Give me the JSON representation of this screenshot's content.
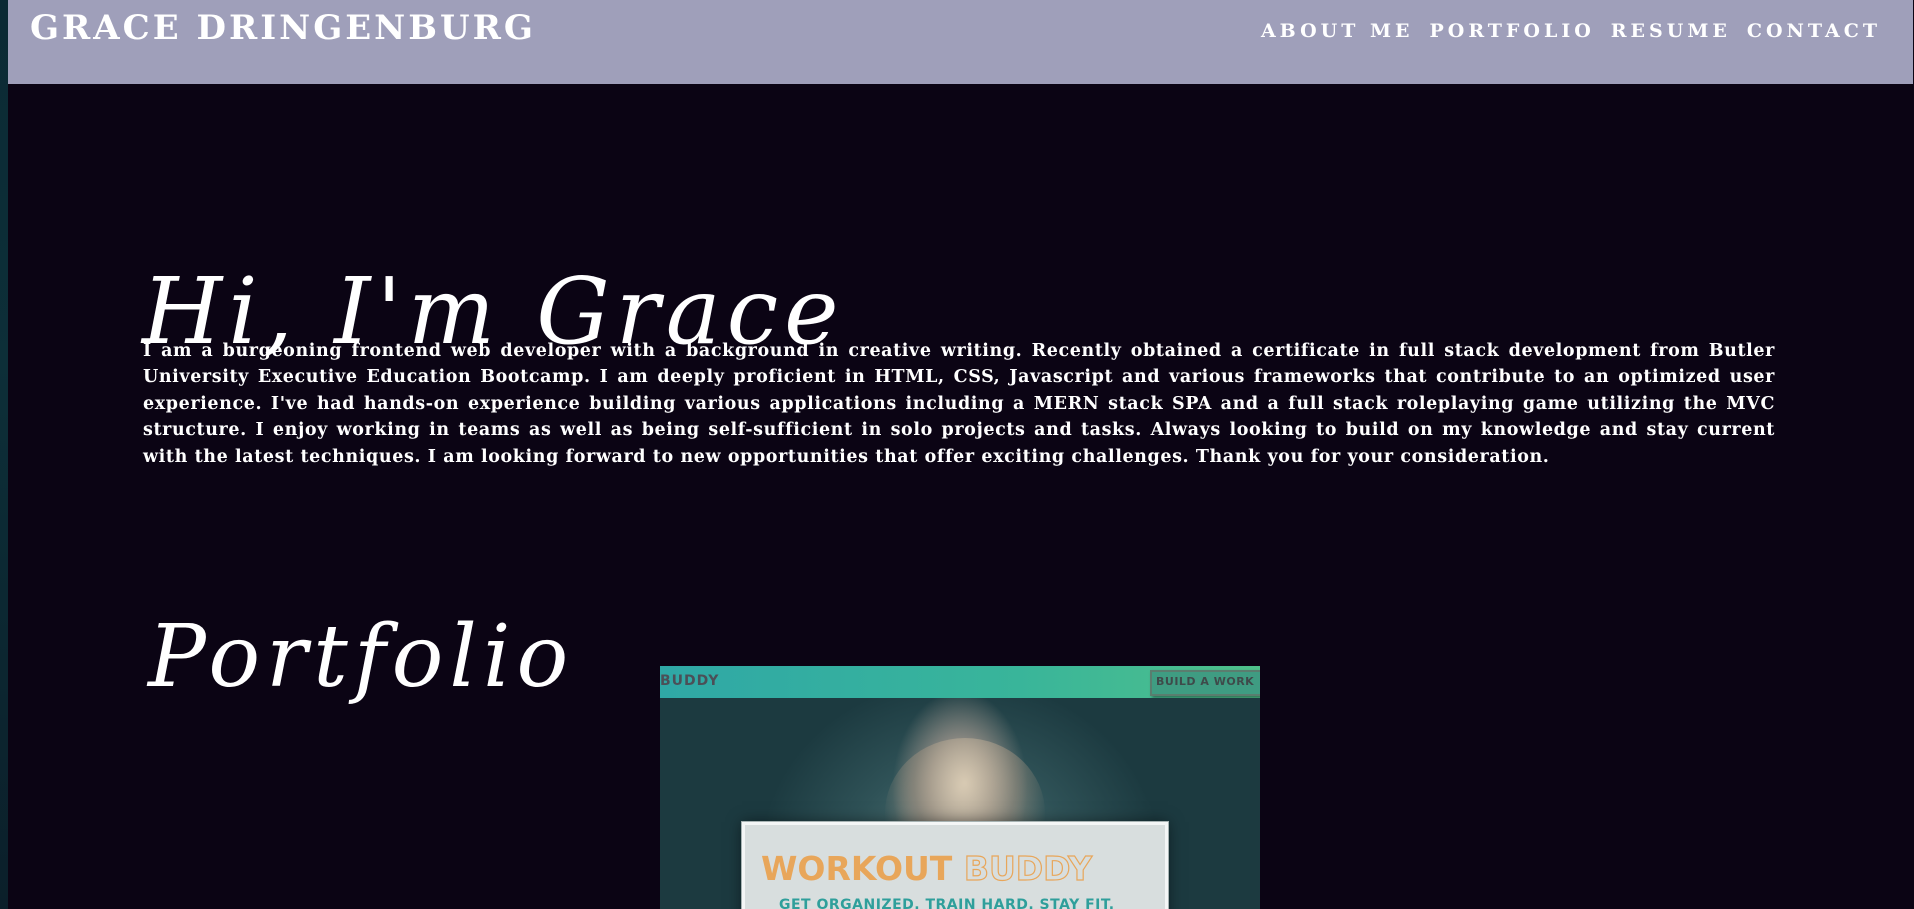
{
  "header": {
    "brand": "GRACE DRINGENBURG",
    "nav": [
      "ABOUT ME",
      "PORTFOLIO",
      "RESUME",
      "CONTACT"
    ]
  },
  "about": {
    "heading": "Hi, I'm Grace",
    "bio": "I am a burgeoning frontend web developer with a background in creative writing. Recently obtained a certificate in full stack development from Butler University Executive Education Bootcamp. I am deeply proficient in HTML, CSS, Javascript and various frameworks that contribute to an optimized user experience. I've had hands-on experience building various applications including a MERN stack SPA and a full stack roleplaying game utilizing the MVC structure. I enjoy working in teams as well as being self-sufficient in solo projects and tasks. Always looking to build on my knowledge and stay current with the latest techniques. I am looking forward to new opportunities that offer exciting challenges. Thank you for your consideration."
  },
  "portfolio": {
    "heading": "Portfolio",
    "project": {
      "nav_brand": "BUDDY",
      "nav_button": "BUILD A WORK",
      "title_part1": "WORKOUT",
      "title_part2": "BUDDY",
      "tagline": "GET ORGANIZED. TRAIN HARD. STAY FIT."
    }
  },
  "colors": {
    "page_background": "#0b0414",
    "header_background": "#9f9fba",
    "text": "#ffffff",
    "project_accent_orange": "#e8a65a",
    "project_accent_teal": "#2f9f9b"
  }
}
